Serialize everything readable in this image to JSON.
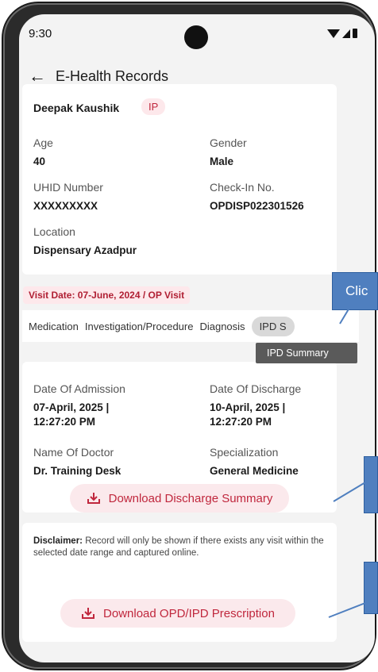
{
  "status": {
    "time": "9:30"
  },
  "appbar": {
    "title": "E-Health Records"
  },
  "patient": {
    "name": "Deepak Kaushik",
    "badge": "IP",
    "age_label": "Age",
    "age_value": "40",
    "gender_label": "Gender",
    "gender_value": "Male",
    "uhid_label": "UHID Number",
    "uhid_value": "XXXXXXXXX",
    "checkin_label": "Check-In No.",
    "checkin_value": "OPDISP022301526",
    "location_label": "Location",
    "location_value": "Dispensary Azadpur"
  },
  "visit": {
    "label": "Visit Date: 07-June, 2024 / OP Visit"
  },
  "tabs": [
    {
      "label": "Medication"
    },
    {
      "label": "Investigation/Procedure"
    },
    {
      "label": "Diagnosis"
    },
    {
      "label": "IPD S"
    }
  ],
  "tooltip": {
    "text": "IPD Summary"
  },
  "admission": {
    "doa_label": "Date Of Admission",
    "doa_value_1": "07-April, 2025 |",
    "doa_value_2": "12:27:20 PM",
    "dod_label": "Date Of Discharge",
    "dod_value_1": "10-April, 2025 |",
    "dod_value_2": "12:27:20 PM",
    "doctor_label": "Name Of Doctor",
    "doctor_value": "Dr. Training Desk",
    "spec_label": "Specialization",
    "spec_value": "General Medicine",
    "download_label": "Download Discharge Summary"
  },
  "disclaimer": {
    "title": "Disclaimer:",
    "text": "Record will only be shown if there exists any visit within the selected date range and captured online.",
    "download_label": "Download OPD/IPD Prescription"
  },
  "callouts": {
    "click_text": "Clic"
  },
  "colors": {
    "accent": "#c0273d",
    "accent_bg": "#fde8eb",
    "callout": "#4f7fbf"
  }
}
